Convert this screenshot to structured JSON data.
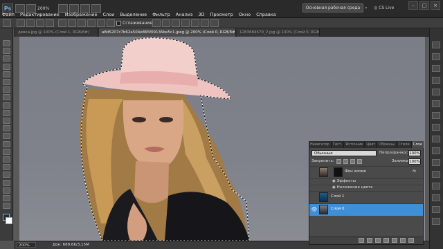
{
  "app": {
    "logo": "Ps",
    "zoom": "200%"
  },
  "menu": [
    "Файл",
    "Редактирование",
    "Изображение",
    "Слои",
    "Выделение",
    "Фильтр",
    "Анализ",
    "3D",
    "Просмотр",
    "Окно",
    "Справка"
  ],
  "workspace": {
    "label": "Основная рабочая среда",
    "cslive": "CS Live"
  },
  "options_bar": {
    "smoothing_label": "Сглаживание",
    "smoothing_checked": true
  },
  "tabs": [
    {
      "label": "девка.jpg @ 100% (Слой 1, RGB/8#)",
      "active": false
    },
    {
      "label": "a8d5207c7b62a504e865f09136be5c1.jpeg @ 200% (Слой 0, RGB/8#)",
      "active": true
    },
    {
      "label": "1283684579_2.jpg @ 100% (Слой 0, RGB/8#)",
      "active": false
    }
  ],
  "colors": {
    "foreground": "#0f3045",
    "background": "#ffffff",
    "selected_layer": "#3d8fd8"
  },
  "status": {
    "zoom": "200%",
    "doc": "Док: 689,6K/3,15M"
  },
  "layers_panel": {
    "tabs": [
      "Навигатор",
      "Гист.",
      "Источник",
      "Цвет",
      "Образцы",
      "Стили",
      "Слои"
    ],
    "active_tab": "Слои",
    "blend_mode": "Обычные",
    "opacity_label": "Непрозрачность:",
    "opacity": "100%",
    "lock_label": "Закрепить:",
    "fill_label": "Заливка:",
    "fill": "100%",
    "layers": [
      {
        "name": "Фон копия",
        "visible": false,
        "selected": false,
        "fx": "fx"
      },
      {
        "name": "Эффекты",
        "visible": false,
        "selected": false,
        "type": "effects"
      },
      {
        "name": "Наложение цвета",
        "visible": false,
        "selected": false,
        "type": "effect"
      },
      {
        "name": "Слой 1",
        "visible": false,
        "selected": false
      },
      {
        "name": "Слой 0",
        "visible": true,
        "selected": true
      }
    ]
  }
}
